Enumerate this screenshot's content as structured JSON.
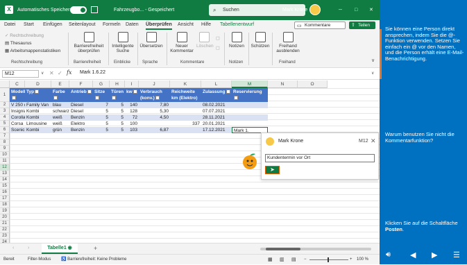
{
  "titlebar": {
    "autosave_label": "Automatisches Speichern",
    "toggle_state": "Ein",
    "file_title": "Fahrzeugbo... - Gespeichert",
    "search_placeholder": "Suchen",
    "user_name": "Mark Krone",
    "minimize": "─",
    "maximize": "□",
    "close": "✕"
  },
  "menu": {
    "items": [
      "Datei",
      "Start",
      "Einfügen",
      "Seitenlayout",
      "Formeln",
      "Daten",
      "Überprüfen",
      "Ansicht",
      "Hilfe",
      "Tabellenentwurf"
    ],
    "active": "Überprüfen",
    "comments_button": "Kommentare",
    "share_button": "Teilen"
  },
  "ribbon": {
    "small_buttons": [
      "Rechtschreibung",
      "Thesaurus",
      "Arbeitsmappenstatistiken"
    ],
    "groups": [
      {
        "label": "Rechtschreibung"
      },
      {
        "label": "Barrierefreiheit",
        "button": "Barrierefreiheit überprüfen"
      },
      {
        "label": "Einblicke",
        "button": "Intelligente Suche"
      },
      {
        "label": "Sprache",
        "button": "Übersetzen"
      },
      {
        "label": "Kommentare",
        "buttons": [
          "Neuer Kommentar",
          "Löschen"
        ]
      },
      {
        "label": "Notizen",
        "button": "Notizen"
      },
      {
        "label": "",
        "button": "Schützen"
      },
      {
        "label": "Freihand",
        "button": "Freihand ausblenden"
      }
    ]
  },
  "formula_bar": {
    "name_box": "M12",
    "fx": "fx",
    "value": "Mark 1.6.22"
  },
  "columns": [
    "C",
    "D",
    "E",
    "F",
    "G",
    "H",
    "I",
    "J",
    "K",
    "L",
    "M",
    "N",
    "O"
  ],
  "table": {
    "headers": [
      "Modell",
      "Typ",
      "Farbe",
      "Antrieb",
      "Sitze",
      "Türen",
      "kw",
      "Verbrauch (konv.)",
      "Reichweite km (Elektro)",
      "Zulassung",
      "Reservierung"
    ],
    "rows": [
      [
        "V 250 d",
        "Family Van",
        "blau",
        "Diesel",
        "7",
        "5",
        "140",
        "7,80",
        "",
        "08.02.2021",
        ""
      ],
      [
        "Insignia",
        "Kombi",
        "schwarz",
        "Diesel",
        "5",
        "5",
        "128",
        "5,30",
        "",
        "07.07.2021",
        ""
      ],
      [
        "Corolla",
        "Kombi",
        "weiß",
        "Benzin",
        "5",
        "5",
        "72",
        "4,50",
        "",
        "28.11.2021",
        ""
      ],
      [
        "Corsa",
        "Limousine",
        "weiß",
        "Elektro",
        "5",
        "5",
        "100",
        "",
        "337",
        "20.01.2021",
        ""
      ],
      [
        "Scenic",
        "Kombi",
        "grün",
        "Benzin",
        "5",
        "5",
        "103",
        "6,87",
        "",
        "17.12.2021",
        "Mark 1."
      ]
    ]
  },
  "row_numbers": [
    "1",
    "2",
    "3",
    "4",
    "5",
    "6",
    "7",
    "8",
    "9",
    "10",
    "11",
    "12",
    "13",
    "14",
    "15",
    "16",
    "17",
    "18",
    "19",
    "20",
    "21",
    "22",
    "23",
    "24",
    "25",
    "26",
    "27"
  ],
  "comment": {
    "author": "Mark Krone",
    "cell_ref": "M12",
    "close": "✕",
    "input_value": "Kundentermin vor Ort",
    "send_icon": "➤"
  },
  "sheet": {
    "tab_name": "Tabelle1",
    "add": "+"
  },
  "status": {
    "mode": "Bereit",
    "filter": "Filter-Modus",
    "accessibility": "Barrierefreiheit: Keine Probleme",
    "zoom": "100 %"
  },
  "panel": {
    "text1": "Sie können eine Person direkt ansprechen, indem Sie die @-Funktion verwenden. Setzen Sie einfach ein @ vor den Namen, und die Person erhält eine E-Mail-Benachrichtigung.",
    "text2": "Warum benutzen Sie nicht die Kommentarfunktion?",
    "text3_prefix": "Klicken Sie auf die Schaltfläche ",
    "text3_bold": "Posten",
    "text3_suffix": ".",
    "accent_color": "#0070c0",
    "excel_green": "#107c41",
    "highlight_orange": "#e8772e"
  }
}
